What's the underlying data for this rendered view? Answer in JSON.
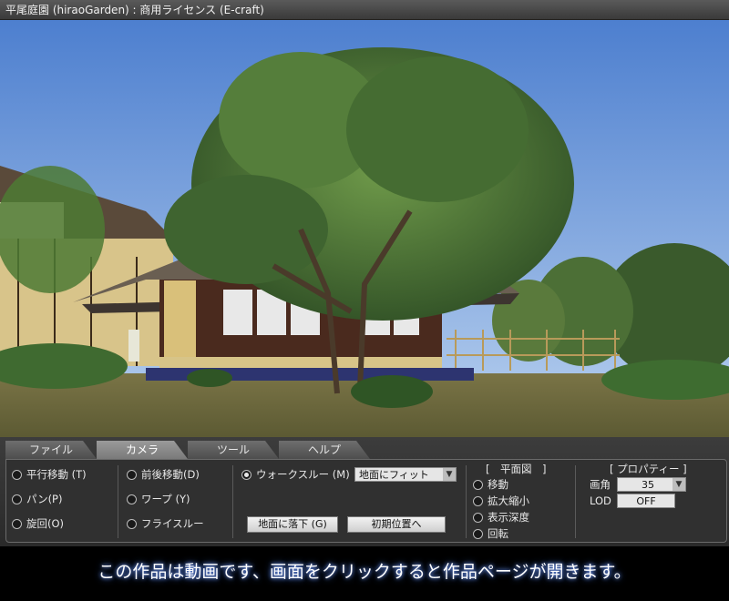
{
  "window": {
    "title": "平尾庭園 (hiraoGarden) : 商用ライセンス (E-craft)"
  },
  "tabs": [
    {
      "label": "ファイル",
      "active": false
    },
    {
      "label": "カメラ",
      "active": true
    },
    {
      "label": "ツール",
      "active": false
    },
    {
      "label": "ヘルプ",
      "active": false
    }
  ],
  "camera": {
    "col1": [
      "平行移動 (T)",
      "パン(P)",
      "旋回(O)"
    ],
    "col2": [
      "前後移動(D)",
      "ワープ (Y)",
      "フライスルー"
    ],
    "walkthrough": {
      "label": "ウォークスルー (M)",
      "selected": true
    },
    "fit_select": {
      "value": "地面にフィット"
    },
    "drop_button": "地面に落下 (G)",
    "initial_button": "初期位置へ"
  },
  "plan_view": {
    "heading": "[　平面図　]",
    "options": [
      "移動",
      "拡大縮小",
      "表示深度",
      "回転"
    ]
  },
  "properties": {
    "heading": "[ プロパティー ]",
    "angle_label": "画角",
    "angle_value": "35",
    "lod_label": "LOD",
    "lod_value": "OFF"
  },
  "footer": {
    "text": "この作品は動画です、画面をクリックすると作品ページが開きます。"
  },
  "colors": {
    "sky": "#6f9bd8",
    "ground": "#6d6a3e",
    "panel": "#303030",
    "tab_active": "#8a8a8a"
  }
}
